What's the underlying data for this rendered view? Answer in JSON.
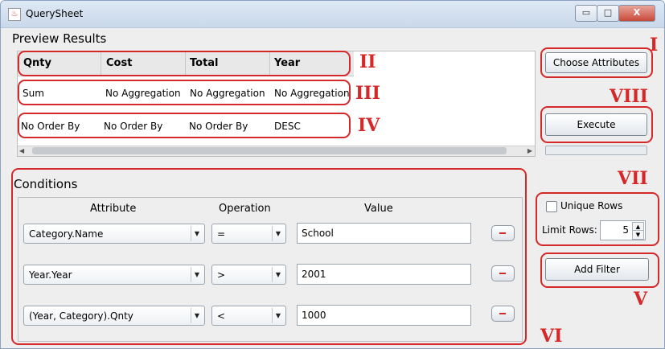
{
  "window": {
    "title": "QuerySheet",
    "controls": {
      "minimize": "▭",
      "maximize": "□",
      "close": "X"
    }
  },
  "preview": {
    "label": "Preview Results",
    "headers": [
      "Qnty",
      "Cost",
      "Total",
      "Year"
    ],
    "aggregation_row": [
      "Sum",
      "No Aggregation",
      "No Aggregation",
      "No Aggregation"
    ],
    "order_row": [
      "No Order By",
      "No Order By",
      "No Order By",
      "DESC"
    ]
  },
  "buttons": {
    "choose_attributes": "Choose Attributes",
    "execute": "Execute",
    "add_filter": "Add Filter"
  },
  "conditions": {
    "label": "Conditions",
    "headers": {
      "attribute": "Attribute",
      "operation": "Operation",
      "value": "Value"
    },
    "rows": [
      {
        "attribute": "Category.Name",
        "operation": "=",
        "value": "School"
      },
      {
        "attribute": "Year.Year",
        "operation": ">",
        "value": "2001"
      },
      {
        "attribute": "(Year, Category).Qnty",
        "operation": "<",
        "value": "1000"
      }
    ]
  },
  "options": {
    "unique_rows_label": "Unique Rows",
    "unique_rows_checked": false,
    "limit_rows_label": "Limit Rows:",
    "limit_rows_value": "5"
  },
  "annotations": {
    "I": "I",
    "II": "II",
    "III": "III",
    "IV": "IV",
    "V": "V",
    "VI": "VI",
    "VII": "VII",
    "VIII": "VIII"
  },
  "colors": {
    "annotation_red": "#d52828",
    "title_gradient_top": "#dfe9f5"
  }
}
